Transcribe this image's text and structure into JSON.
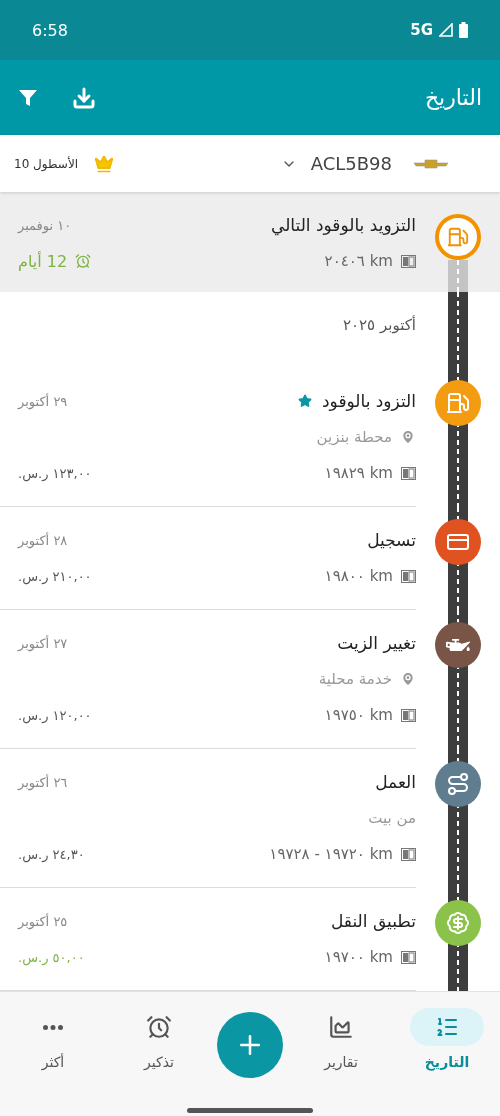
{
  "status_bar": {
    "time": "6:58",
    "network": "5G"
  },
  "app_bar": {
    "title": "التاريخ"
  },
  "vehicle_bar": {
    "plate": "ACL5B98",
    "fleet": "الأسطول 10"
  },
  "upcoming": {
    "title": "التزويد بالوقود التالي",
    "date": "١٠ نوفمبر",
    "odometer": "km ٢٠٤٠٦",
    "remaining": "12 أيام",
    "kind": "fuel",
    "color": "#f39200"
  },
  "month": "أكتوبر ٢٠٢٥",
  "entries": [
    {
      "kind": "fuel",
      "color": "#f39c12",
      "title": "التزود بالوقود",
      "favorite": true,
      "date": "٢٩ أكتوبر",
      "subtitle": {
        "kind": "location",
        "text": "محطة بنزين"
      },
      "odometer": "km ١٩٨٢٩",
      "cost": "١٢٣,٠٠ ر.س.",
      "income": false
    },
    {
      "kind": "expense",
      "color": "#e0521f",
      "title": "تسجيل",
      "favorite": false,
      "date": "٢٨ أكتوبر",
      "odometer": "km ١٩٨٠٠",
      "cost": "٢١٠,٠٠ ر.س.",
      "income": false
    },
    {
      "kind": "service",
      "color": "#795548",
      "title": "تغيير الزيت",
      "favorite": false,
      "date": "٢٧ أكتوبر",
      "subtitle": {
        "kind": "location",
        "text": "خدمة محلية"
      },
      "odometer": "km ١٩٧٥٠",
      "cost": "١٢٠,٠٠ ر.س.",
      "income": false
    },
    {
      "kind": "route",
      "color": "#5f7d8e",
      "title": "العمل",
      "favorite": false,
      "date": "٢٦ أكتوبر",
      "subtitle": {
        "kind": "note",
        "text": "من بيت"
      },
      "odometer": "km ١٩٧٢٠ - ١٩٧٢٨",
      "cost": "٢٤,٣٠ ر.س.",
      "income": false
    },
    {
      "kind": "income",
      "color": "#8bc34a",
      "title": "تطبيق النقل",
      "favorite": false,
      "date": "٢٥ أكتوبر",
      "odometer": "km ١٩٧٠٠",
      "cost": "٥٠,٠٠ ر.س.",
      "income": true
    }
  ],
  "bottom_nav": [
    {
      "kind": "history",
      "label": "التاريخ",
      "selected": true
    },
    {
      "kind": "reports",
      "label": "تقارير",
      "selected": false
    },
    {
      "kind": "add"
    },
    {
      "kind": "reminders",
      "label": "تذكير",
      "selected": false
    },
    {
      "kind": "more",
      "label": "أكثر",
      "selected": false
    }
  ]
}
